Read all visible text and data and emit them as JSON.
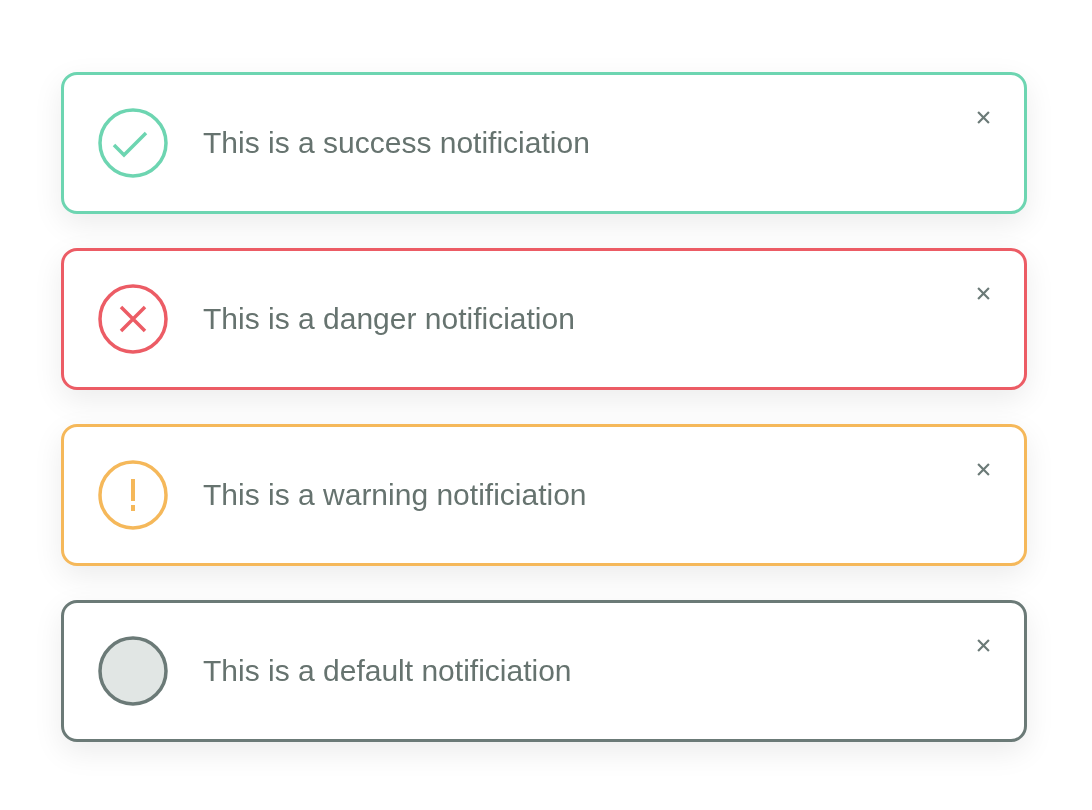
{
  "notifications": [
    {
      "kind": "success",
      "message": "This is a success notificiation"
    },
    {
      "kind": "danger",
      "message": "This is a danger notificiation"
    },
    {
      "kind": "warning",
      "message": "This is a warning notificiation"
    },
    {
      "kind": "default",
      "message": "This is a default notificiation"
    }
  ]
}
